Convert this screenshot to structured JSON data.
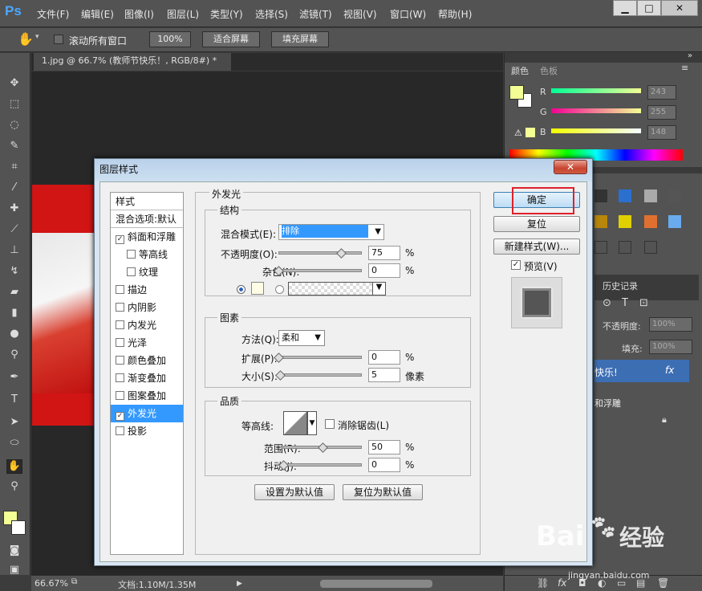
{
  "app": {
    "logo": "Ps"
  },
  "menu": [
    "文件(F)",
    "编辑(E)",
    "图像(I)",
    "图层(L)",
    "类型(Y)",
    "选择(S)",
    "滤镜(T)",
    "视图(V)",
    "窗口(W)",
    "帮助(H)"
  ],
  "window_controls": {
    "minimize": "▁",
    "restore": "□",
    "close": "✕"
  },
  "options": {
    "scroll_all": "滚动所有窗口",
    "zoom": "100%",
    "fit_screen": "适合屏幕",
    "fill_screen": "填充屏幕"
  },
  "document": {
    "tab": "1.jpg @ 66.7% (教师节快乐！, RGB/8#) *",
    "close": "×"
  },
  "status": {
    "zoom": "66.67%",
    "doc": "文档:1.10M/1.35M"
  },
  "color_panel": {
    "tab1": "颜色",
    "tab2": "色板",
    "r_label": "R",
    "g_label": "G",
    "b_label": "B",
    "r": "243",
    "g": "255",
    "b": "148",
    "fg": "#f3ff94"
  },
  "history_panel": {
    "tab": "历史记录",
    "opacity_label": "不透明度:",
    "opacity": "100%",
    "fill_label": "填充:",
    "fill": "100%",
    "layer_name": "快乐!",
    "fx": "fx",
    "effect": "和浮雕"
  },
  "dialog": {
    "title": "图层样式",
    "close": "✕",
    "styles_header": "样式",
    "blend_default": "混合选项:默认",
    "items": [
      {
        "label": "斜面和浮雕",
        "checked": true,
        "indent": false
      },
      {
        "label": "等高线",
        "checked": false,
        "indent": true
      },
      {
        "label": "纹理",
        "checked": false,
        "indent": true
      },
      {
        "label": "描边",
        "checked": false,
        "indent": false
      },
      {
        "label": "内阴影",
        "checked": false,
        "indent": false
      },
      {
        "label": "内发光",
        "checked": false,
        "indent": false
      },
      {
        "label": "光泽",
        "checked": false,
        "indent": false
      },
      {
        "label": "颜色叠加",
        "checked": false,
        "indent": false
      },
      {
        "label": "渐变叠加",
        "checked": false,
        "indent": false
      },
      {
        "label": "图案叠加",
        "checked": false,
        "indent": false
      },
      {
        "label": "外发光",
        "checked": true,
        "indent": false,
        "selected": true
      },
      {
        "label": "投影",
        "checked": false,
        "indent": false
      }
    ],
    "section_title": "外发光",
    "structure": {
      "title": "结构",
      "blend_mode_label": "混合模式(E):",
      "blend_mode": "排除",
      "opacity_label": "不透明度(O):",
      "opacity": "75",
      "noise_label": "杂色(N):",
      "noise": "0",
      "pct": "%"
    },
    "elements": {
      "title": "图素",
      "method_label": "方法(Q):",
      "method": "柔和",
      "spread_label": "扩展(P):",
      "spread": "0",
      "size_label": "大小(S):",
      "size": "5",
      "px": "像素"
    },
    "quality": {
      "title": "品质",
      "contour_label": "等高线:",
      "antialias": "消除锯齿(L)",
      "range_label": "范围(R):",
      "range": "50",
      "jitter_label": "抖动(J):",
      "jitter": "0"
    },
    "make_default": "设置为默认值",
    "reset_default": "复位为默认值",
    "ok": "确定",
    "reset": "复位",
    "new_style": "新建样式(W)...",
    "preview": "预览(V)"
  },
  "watermark": {
    "text": "Bai",
    "text2": "经验",
    "sub": "jingyan.baidu.com"
  }
}
